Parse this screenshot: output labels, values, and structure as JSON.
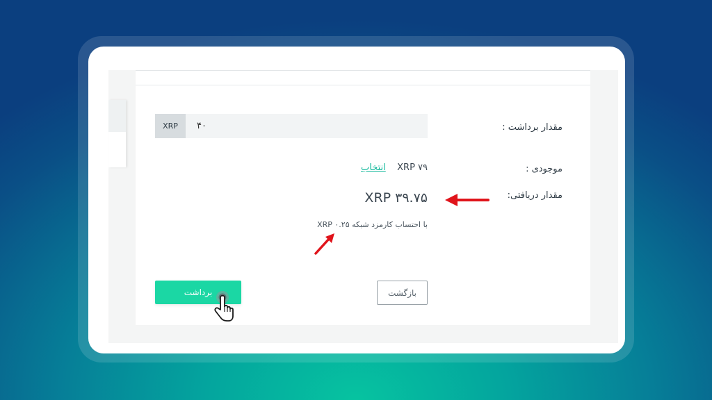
{
  "form": {
    "amount_label": "مقدار برداشت :",
    "amount_unit": "XRP",
    "amount_value": "۴۰",
    "balance_label": "موجودی :",
    "balance_value": "XRP ۷۹",
    "select_link": "انتخاب",
    "received_label": "مقدار دریافتی:",
    "received_value": "XRP ۳۹.۷۵",
    "fee_note": "با احتساب کارمزد شبکه XRP ۰.۲۵"
  },
  "buttons": {
    "withdraw": "برداشت",
    "back": "بازگشت"
  },
  "colors": {
    "accent": "#1bd7a4",
    "link": "#12b89b",
    "annotation_arrow": "#e0141b"
  },
  "icons": {
    "pointer": "pointing-hand-cursor-icon",
    "annotation": "red-arrow-icon"
  }
}
